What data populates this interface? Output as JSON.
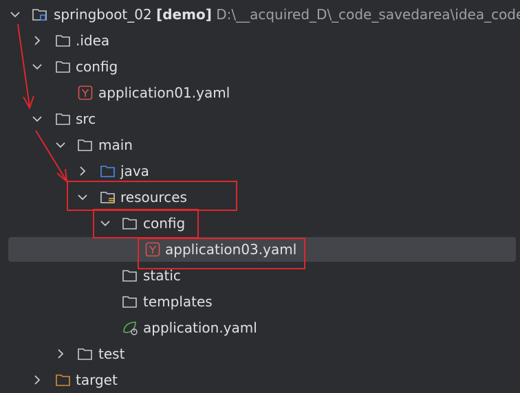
{
  "tree": {
    "project": {
      "name": "springboot_02",
      "module": "[demo]",
      "path": "D:\\__acquired_D\\_code_savedarea\\idea_code"
    },
    "idea": ".idea",
    "config": "config",
    "app01": "application01.yaml",
    "src": "src",
    "main": "main",
    "java": "java",
    "resources": "resources",
    "res_config": "config",
    "app03": "application03.yaml",
    "static": "static",
    "templates": "templates",
    "application": "application.yaml",
    "test": "test",
    "target": "target"
  },
  "colors": {
    "highlight": "#e0262d",
    "yaml_icon": "#d9534f",
    "java_folder": "#4d8bef",
    "spring_leaf": "#5fb05a"
  }
}
